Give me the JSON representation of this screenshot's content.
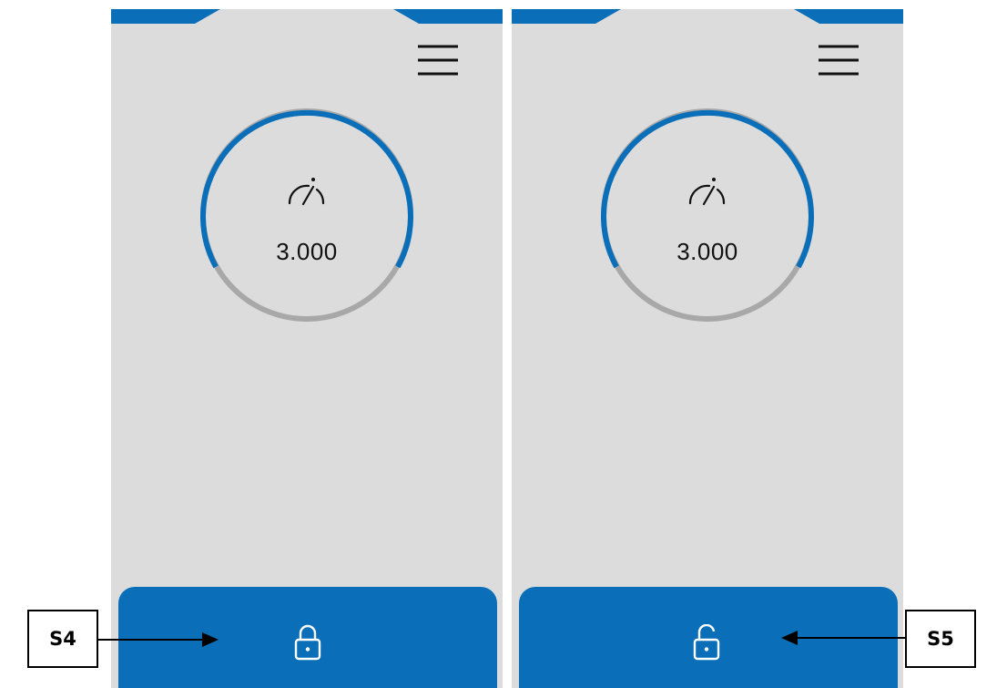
{
  "colors": {
    "accent": "#0a6fb8",
    "panel_bg": "#dcdcdc",
    "gauge_track": "#a8a8a8",
    "icon_dark": "#111111",
    "lock_icon": "#ffffff"
  },
  "screens": [
    {
      "id": "left",
      "menu_icon": "hamburger-menu-icon",
      "gauge_icon": "speedometer-icon",
      "value": "3.000",
      "gauge_fill_fraction": 0.68,
      "lock_icon": "padlock-closed-icon"
    },
    {
      "id": "right",
      "menu_icon": "hamburger-menu-icon",
      "gauge_icon": "speedometer-icon",
      "value": "3.000",
      "gauge_fill_fraction": 0.68,
      "lock_icon": "padlock-open-icon"
    }
  ],
  "annotations": {
    "left_label": "S4",
    "right_label": "S5"
  }
}
